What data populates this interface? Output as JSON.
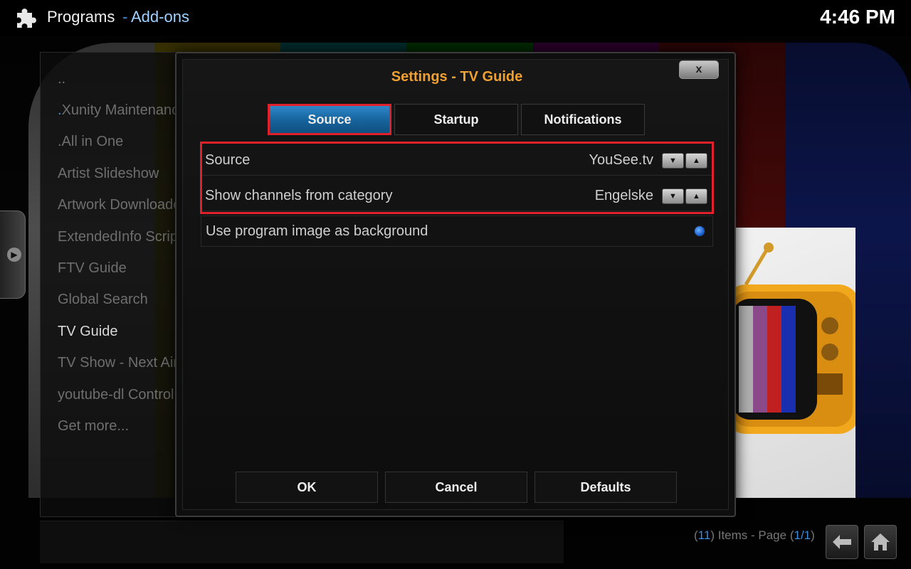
{
  "topbar": {
    "section": "Programs",
    "separator": "-",
    "subsection": "Add-ons",
    "clock": "4:46 PM"
  },
  "addon_list": {
    "items": [
      {
        "label": ".."
      },
      {
        "prefix": ".",
        "label": "Xunity Maintenance"
      },
      {
        "label": ".All in One"
      },
      {
        "label": "Artist Slideshow"
      },
      {
        "label": "Artwork Downloader"
      },
      {
        "label": "ExtendedInfo Script"
      },
      {
        "label": "FTV Guide"
      },
      {
        "label": "Global Search"
      },
      {
        "label": "TV Guide",
        "selected": true
      },
      {
        "label": "TV Show - Next Aired"
      },
      {
        "label": "youtube-dl Control"
      },
      {
        "label": "Get more..."
      }
    ]
  },
  "footer": {
    "count": "11",
    "items_label": "Items - Page",
    "page": "1/1"
  },
  "dialog": {
    "title": "Settings - TV Guide",
    "close_label": "x",
    "tabs": [
      {
        "label": "Source",
        "active": true
      },
      {
        "label": "Startup",
        "active": false
      },
      {
        "label": "Notifications",
        "active": false
      }
    ],
    "settings": [
      {
        "label": "Source",
        "value": "YouSee.tv",
        "control": "spinner"
      },
      {
        "label": "Show channels from category",
        "value": "Engelske",
        "control": "spinner"
      },
      {
        "label": "Use program image as background",
        "control": "radio",
        "checked": true
      }
    ],
    "buttons": {
      "ok": "OK",
      "cancel": "Cancel",
      "defaults": "Defaults"
    }
  },
  "colors": {
    "title_orange": "#f0a030",
    "accent_blue": "#3a8fe0",
    "active_tab_blue": "#17659f",
    "highlight_red": "#e0202a"
  },
  "icons": {
    "addon": "puzzle-icon",
    "back": "back-arrow-icon",
    "home": "home-icon",
    "spin_down": "triangle-down-icon",
    "spin_up": "triangle-up-icon"
  }
}
